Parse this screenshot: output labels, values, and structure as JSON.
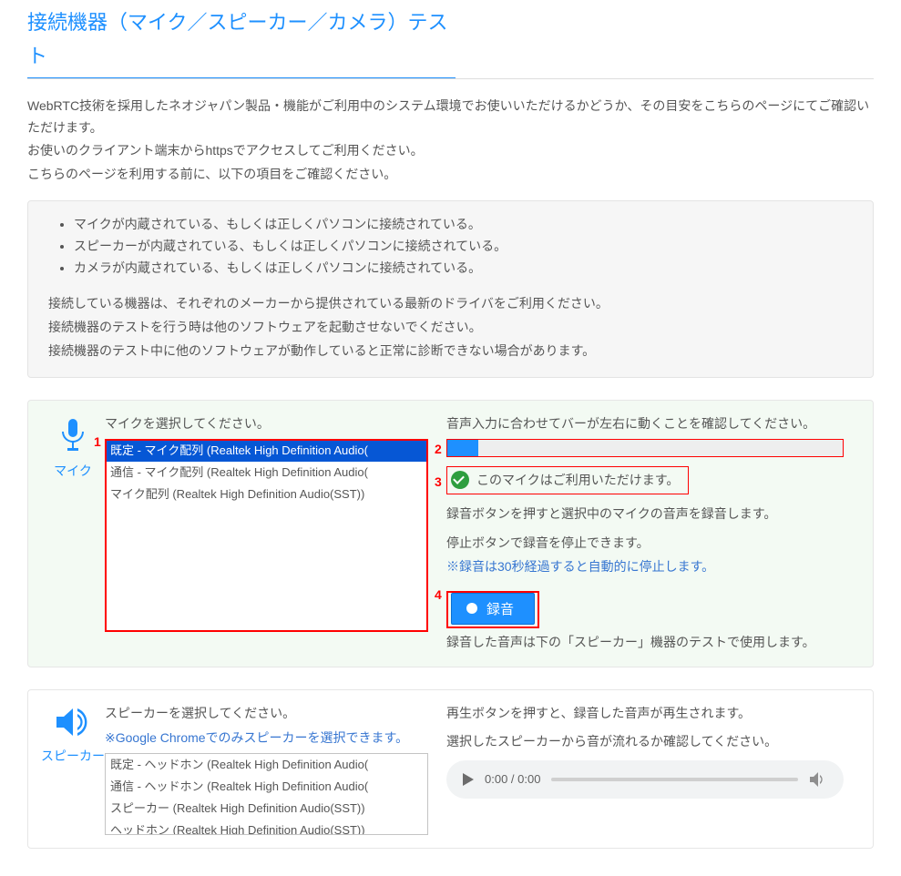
{
  "page_title": "接続機器（マイク／スピーカー／カメラ）テスト",
  "intro": {
    "p1": "WebRTC技術を採用したネオジャパン製品・機能がご利用中のシステム環境でお使いいただけるかどうか、その目安をこちらのページにてご確認いただけます。",
    "p2": "お使いのクライアント端末からhttpsでアクセスしてご利用ください。",
    "p3": "こちらのページを利用する前に、以下の項目をご確認ください。"
  },
  "notes": {
    "items": [
      "マイクが内蔵されている、もしくは正しくパソコンに接続されている。",
      "スピーカーが内蔵されている、もしくは正しくパソコンに接続されている。",
      "カメラが内蔵されている、もしくは正しくパソコンに接続されている。"
    ],
    "p1": "接続している機器は、それぞれのメーカーから提供されている最新のドライバをご利用ください。",
    "p2": "接続機器のテストを行う時は他のソフトウェアを起動させないでください。",
    "p3": "接続機器のテスト中に他のソフトウェアが動作していると正常に診断できない場合があります。"
  },
  "mic_panel": {
    "side_label": "マイク",
    "select_label": "マイクを選択してください。",
    "options": [
      "既定 - マイク配列 (Realtek High Definition Audio(",
      "通信 - マイク配列 (Realtek High Definition Audio(",
      "マイク配列 (Realtek High Definition Audio(SST))"
    ],
    "meter_label": "音声入力に合わせてバーが左右に動くことを確認してください。",
    "status_text": "このマイクはご利用いただけます。",
    "rec_note_1": "録音ボタンを押すと選択中のマイクの音声を録音します。",
    "rec_note_2": "停止ボタンで録音を停止できます。",
    "rec_note_3": "※録音は30秒経過すると自動的に停止します。",
    "record_button_label": "録音",
    "below_record": "録音した音声は下の「スピーカー」機器のテストで使用します。",
    "annot": {
      "n1": "1",
      "n2": "2",
      "n3": "3",
      "n4": "4"
    }
  },
  "speaker_panel": {
    "side_label": "スピーカー",
    "select_label": "スピーカーを選択してください。",
    "chrome_note": "※Google Chromeでのみスピーカーを選択できます。",
    "options": [
      "既定 - ヘッドホン (Realtek High Definition Audio(",
      "通信 - ヘッドホン (Realtek High Definition Audio(",
      "スピーカー (Realtek High Definition Audio(SST))",
      "ヘッドホン (Realtek High Definition Audio(SST))"
    ],
    "play_note_1": "再生ボタンを押すと、録音した音声が再生されます。",
    "play_note_2": "選択したスピーカーから音が流れるか確認してください。",
    "time_current": "0:00",
    "time_total": "0:00"
  }
}
